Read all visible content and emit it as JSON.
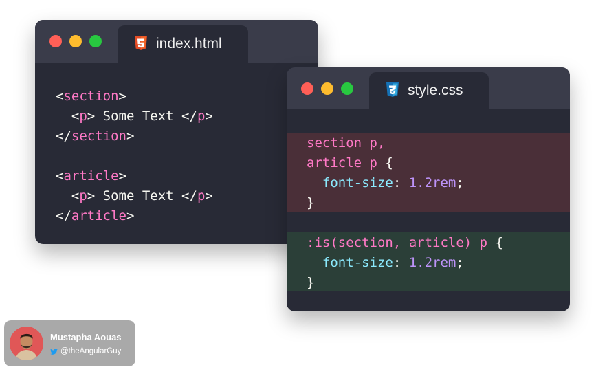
{
  "window_html": {
    "tab_label": "index.html",
    "tab_icon": "html5-icon",
    "code_lines": [
      [
        {
          "t": "<",
          "c": "plain"
        },
        {
          "t": "section",
          "c": "tag"
        },
        {
          "t": ">",
          "c": "plain"
        }
      ],
      [
        {
          "t": "  <",
          "c": "plain"
        },
        {
          "t": "p",
          "c": "tag"
        },
        {
          "t": "> Some Text </",
          "c": "plain"
        },
        {
          "t": "p",
          "c": "tag"
        },
        {
          "t": ">",
          "c": "plain"
        }
      ],
      [
        {
          "t": "</",
          "c": "plain"
        },
        {
          "t": "section",
          "c": "tag"
        },
        {
          "t": ">",
          "c": "plain"
        }
      ],
      [
        {
          "t": "",
          "c": "plain"
        }
      ],
      [
        {
          "t": "<",
          "c": "plain"
        },
        {
          "t": "article",
          "c": "tag"
        },
        {
          "t": ">",
          "c": "plain"
        }
      ],
      [
        {
          "t": "  <",
          "c": "plain"
        },
        {
          "t": "p",
          "c": "tag"
        },
        {
          "t": "> Some Text </",
          "c": "plain"
        },
        {
          "t": "p",
          "c": "tag"
        },
        {
          "t": ">",
          "c": "plain"
        }
      ],
      [
        {
          "t": "</",
          "c": "plain"
        },
        {
          "t": "article",
          "c": "tag"
        },
        {
          "t": ">",
          "c": "plain"
        }
      ]
    ]
  },
  "window_css": {
    "tab_label": "style.css",
    "tab_icon": "css3-icon",
    "block_old": [
      [
        {
          "t": "section p,",
          "c": "tag"
        }
      ],
      [
        {
          "t": "article p",
          "c": "tag"
        },
        {
          "t": " {",
          "c": "plain"
        }
      ],
      [
        {
          "t": "  ",
          "c": "plain"
        },
        {
          "t": "font-size",
          "c": "prop"
        },
        {
          "t": ": ",
          "c": "plain"
        },
        {
          "t": "1.2rem",
          "c": "num"
        },
        {
          "t": ";",
          "c": "plain"
        }
      ],
      [
        {
          "t": "}",
          "c": "plain"
        }
      ]
    ],
    "block_new": [
      [
        {
          "t": ":is(section, article) p",
          "c": "tag"
        },
        {
          "t": " {",
          "c": "plain"
        }
      ],
      [
        {
          "t": "  ",
          "c": "plain"
        },
        {
          "t": "font-size",
          "c": "prop"
        },
        {
          "t": ": ",
          "c": "plain"
        },
        {
          "t": "1.2rem",
          "c": "num"
        },
        {
          "t": ";",
          "c": "plain"
        }
      ],
      [
        {
          "t": "}",
          "c": "plain"
        }
      ]
    ]
  },
  "author": {
    "name": "Mustapha Aouas",
    "handle": "@theAngularGuy",
    "handle_icon": "twitter-icon"
  },
  "colors": {
    "tag": "#ff79c6",
    "property": "#8be9fd",
    "number": "#bd93f9",
    "plain": "#f8f8f2",
    "highlight_old": "#4a2f38",
    "highlight_new": "#2b3f38"
  }
}
